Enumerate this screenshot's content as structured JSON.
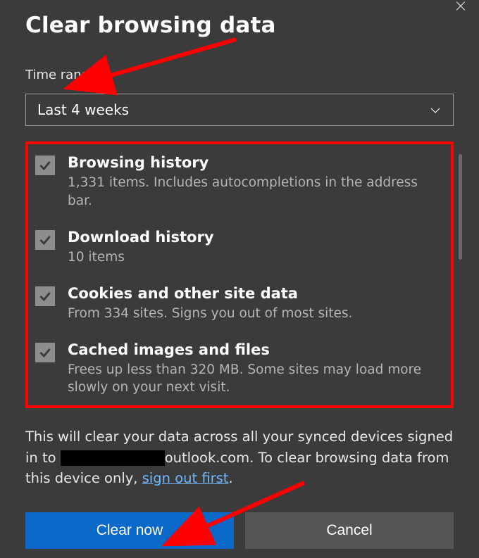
{
  "dialog": {
    "title": "Clear browsing data",
    "close_label": "×"
  },
  "time_range": {
    "label": "Time range",
    "selected": "Last 4 weeks"
  },
  "options": [
    {
      "title": "Browsing history",
      "desc": "1,331 items. Includes autocompletions in the address bar.",
      "checked": true
    },
    {
      "title": "Download history",
      "desc": "10 items",
      "checked": true
    },
    {
      "title": "Cookies and other site data",
      "desc": "From 334 sites. Signs you out of most sites.",
      "checked": true
    },
    {
      "title": "Cached images and files",
      "desc": "Frees up less than 320 MB. Some sites may load more slowly on your next visit.",
      "checked": true
    }
  ],
  "footer": {
    "line1": "This will clear your data across all your synced devices signed in to ",
    "email_domain": "outlook.com",
    "line2_after_email": ". To clear browsing data from this device only, ",
    "link": "sign out first",
    "period": "."
  },
  "buttons": {
    "primary": "Clear now",
    "secondary": "Cancel"
  }
}
